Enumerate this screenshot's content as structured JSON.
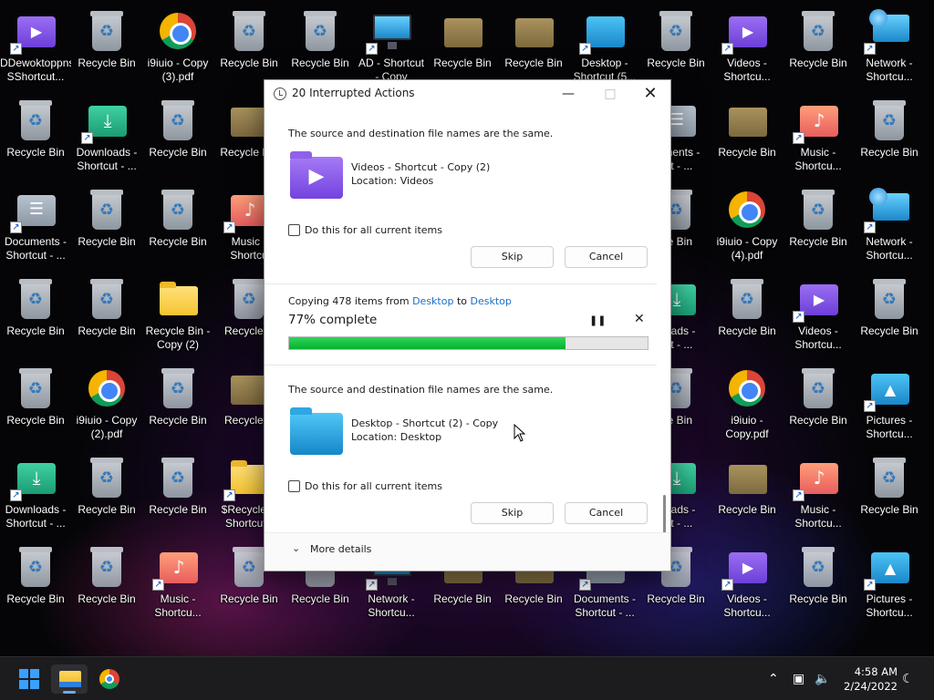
{
  "desktop": {
    "icons": [
      {
        "label": "DDewoktoppns\nSShortcut...",
        "type": "video",
        "shortcut": true
      },
      {
        "label": "Recycle Bin",
        "type": "bin"
      },
      {
        "label": "i9iuio - Copy\n(3).pdf",
        "type": "chrome"
      },
      {
        "label": "Recycle Bin",
        "type": "bin"
      },
      {
        "label": "Recycle Bin",
        "type": "bin"
      },
      {
        "label": "AD - Shortcut\n- Copy",
        "type": "monitor",
        "shortcut": true
      },
      {
        "label": "Recycle Bin",
        "type": "brown"
      },
      {
        "label": "Recycle Bin",
        "type": "brown"
      },
      {
        "label": "Desktop -\nShortcut (5...",
        "type": "desk",
        "shortcut": true
      },
      {
        "label": "Recycle Bin",
        "type": "bin"
      },
      {
        "label": "Videos -\nShortcu...",
        "type": "video",
        "shortcut": true
      },
      {
        "label": "Recycle Bin",
        "type": "bin"
      },
      {
        "label": "Network -\nShortcu...",
        "type": "net",
        "shortcut": true
      },
      {
        "label": "Recycle Bin",
        "type": "bin"
      },
      {
        "label": "Downloads -\nShortcut - ...",
        "type": "down",
        "shortcut": true
      },
      {
        "label": "Recycle Bin",
        "type": "bin"
      },
      {
        "label": "Recycle Bin",
        "type": "brown"
      },
      {
        "label": "cuments -\ncut - ...",
        "type": "docs"
      },
      {
        "label": "Recycle Bin",
        "type": "brown"
      },
      {
        "label": "Music -\nShortcu...",
        "type": "music",
        "shortcut": true
      },
      {
        "label": "Recycle Bin",
        "type": "bin"
      },
      {
        "label": "Documents -\nShortcut - ...",
        "type": "docs",
        "shortcut": true
      },
      {
        "label": "Recycle Bin",
        "type": "bin"
      },
      {
        "label": "Recycle Bin",
        "type": "bin"
      },
      {
        "label": "Music -\nShortcu",
        "type": "music",
        "shortcut": true
      },
      {
        "label": "cle Bin",
        "type": "bin"
      },
      {
        "label": "i9iuio - Copy\n(4).pdf",
        "type": "chrome"
      },
      {
        "label": "Recycle Bin",
        "type": "bin"
      },
      {
        "label": "Network -\nShortcu...",
        "type": "net",
        "shortcut": true
      },
      {
        "label": "Recycle Bin",
        "type": "bin"
      },
      {
        "label": "Recycle Bin",
        "type": "bin"
      },
      {
        "label": "Recycle Bin -\nCopy (2)",
        "type": "folder"
      },
      {
        "label": "Recycle E",
        "type": "bin"
      },
      {
        "label": "nloads -\ncut - ...",
        "type": "down"
      },
      {
        "label": "Recycle Bin",
        "type": "bin"
      },
      {
        "label": "Videos -\nShortcu...",
        "type": "video",
        "shortcut": true
      },
      {
        "label": "Recycle Bin",
        "type": "bin"
      },
      {
        "label": "Recycle Bin",
        "type": "bin"
      },
      {
        "label": "i9iuio - Copy\n(2).pdf",
        "type": "chrome"
      },
      {
        "label": "Recycle Bin",
        "type": "bin"
      },
      {
        "label": "Recycle E",
        "type": "brown"
      },
      {
        "label": "cle Bin",
        "type": "bin"
      },
      {
        "label": "i9iuio -\nCopy.pdf",
        "type": "chrome"
      },
      {
        "label": "Recycle Bin",
        "type": "bin"
      },
      {
        "label": "Pictures -\nShortcu...",
        "type": "pics",
        "shortcut": true
      },
      {
        "label": "Downloads -\nShortcut - ...",
        "type": "down",
        "shortcut": true
      },
      {
        "label": "Recycle Bin",
        "type": "bin"
      },
      {
        "label": "Recycle Bin",
        "type": "bin"
      },
      {
        "label": "$Recycle.E\nShortcut -",
        "type": "folder",
        "shortcut": true
      },
      {
        "label": "nloads -\ncut - ...",
        "type": "down"
      },
      {
        "label": "Recycle Bin",
        "type": "brown"
      },
      {
        "label": "Music -\nShortcu...",
        "type": "music",
        "shortcut": true
      },
      {
        "label": "Recycle Bin",
        "type": "bin"
      },
      {
        "label": "Recycle Bin",
        "type": "bin"
      },
      {
        "label": "Recycle Bin",
        "type": "bin"
      },
      {
        "label": "Music -\nShortcu...",
        "type": "music",
        "shortcut": true
      },
      {
        "label": "Recycle Bin",
        "type": "bin"
      },
      {
        "label": "Recycle Bin",
        "type": "bin"
      },
      {
        "label": "Network -\nShortcu...",
        "type": "monitor",
        "shortcut": true
      },
      {
        "label": "Recycle Bin",
        "type": "brown"
      },
      {
        "label": "Recycle Bin",
        "type": "brown"
      },
      {
        "label": "Documents -\nShortcut - ...",
        "type": "docs",
        "shortcut": true
      },
      {
        "label": "Recycle Bin",
        "type": "bin"
      },
      {
        "label": "Videos -\nShortcu...",
        "type": "video",
        "shortcut": true
      },
      {
        "label": "Recycle Bin",
        "type": "bin"
      },
      {
        "label": "Pictures -\nShortcu...",
        "type": "pics",
        "shortcut": true
      }
    ]
  },
  "dialog": {
    "title": "20 Interrupted Actions",
    "conflict1": {
      "message": "The source and destination file names are the same.",
      "file_name": "Videos - Shortcut - Copy (2)",
      "location": "Location: Videos",
      "file_icon": "video-folder-icon",
      "checkbox_label": "Do this for all current items",
      "checked": false,
      "skip_label": "Skip",
      "cancel_label": "Cancel"
    },
    "progress": {
      "copy_prefix": "Copying 478 items from ",
      "source": "Desktop",
      "to_word": " to ",
      "destination": "Desktop",
      "percent_text": "77% complete",
      "percent": 77,
      "pause_icon": "pause-icon",
      "stop_icon": "close-icon"
    },
    "conflict2": {
      "message": "The source and destination file names are the same.",
      "file_name": "Desktop - Shortcut (2) - Copy",
      "location": "Location: Desktop",
      "file_icon": "desktop-folder-icon",
      "checkbox_label": "Do this for all current items",
      "checked": false,
      "skip_label": "Skip",
      "cancel_label": "Cancel"
    },
    "more_details_label": "More details"
  },
  "taskbar": {
    "time": "4:58 AM",
    "date": "2/24/2022",
    "accent_color": "#3aa0ff"
  },
  "colors": {
    "progress_fill": "#07b02f",
    "link": "#1a6fc9"
  }
}
